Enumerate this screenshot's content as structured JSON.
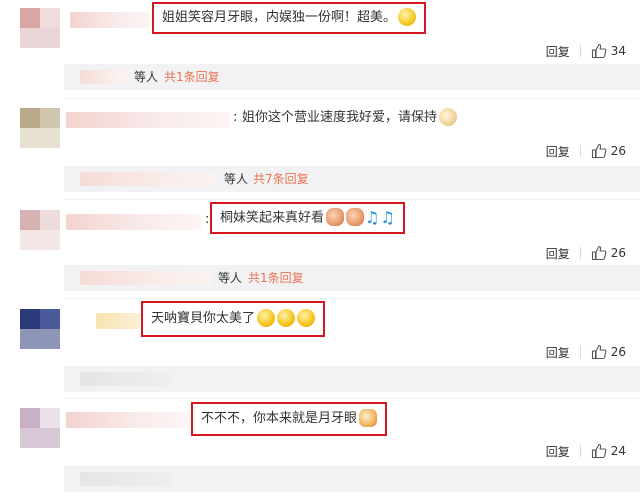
{
  "comments": [
    {
      "text": "姐姐笑容月牙眼，内娱独一份啊！超美。",
      "emoji": [
        "smile"
      ],
      "reply_label": "回复",
      "likes": "34",
      "thread": {
        "who": "等人",
        "link": "共1条回复"
      }
    },
    {
      "colon": ":",
      "text": "姐你这个营业速度我好爱，请保持",
      "emoji": [
        "doge"
      ],
      "reply_label": "回复",
      "likes": "26",
      "thread": {
        "who": "等人",
        "link": "共7条回复"
      }
    },
    {
      "colon": ":",
      "text": "桐妹笑起来真好看",
      "emoji": [
        "monkey",
        "monkey",
        "music-note",
        "music-note"
      ],
      "reply_label": "回复",
      "likes": "26",
      "thread": {
        "who": "等人",
        "link": "共1条回复"
      }
    },
    {
      "text": "天呐寶貝你太美了",
      "emoji": [
        "crying-face",
        "crying-face",
        "crying-face"
      ],
      "reply_label": "回复",
      "likes": "26"
    },
    {
      "text": "不不不，你本来就是月牙眼",
      "emoji": [
        "cat"
      ],
      "reply_label": "回复",
      "likes": "24"
    }
  ],
  "colors": {
    "highlight": "#d4171f",
    "link": "#eb7350",
    "sub_bg": "#f2f2f5"
  }
}
